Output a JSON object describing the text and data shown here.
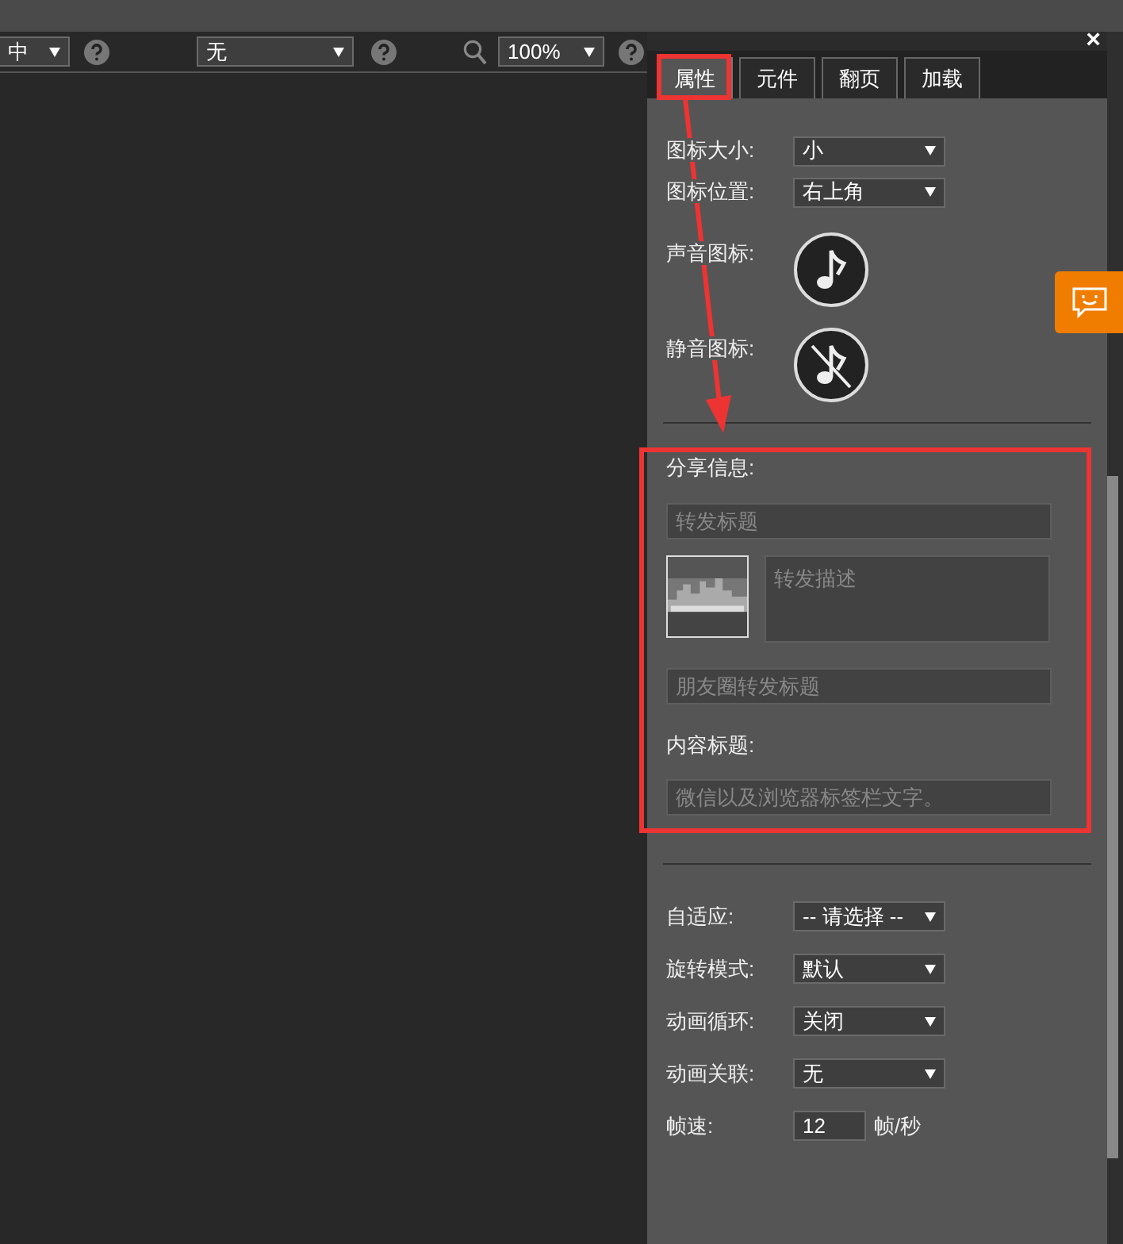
{
  "toolbar": {
    "selects": [
      {
        "value": "中"
      },
      {
        "value": "无"
      },
      {
        "value": "100%"
      }
    ]
  },
  "panel": {
    "close": "×",
    "tabs": [
      {
        "label": "属性",
        "selected": true
      },
      {
        "label": "元件",
        "selected": false
      },
      {
        "label": "翻页",
        "selected": false
      },
      {
        "label": "加载",
        "selected": false
      }
    ],
    "icon_settings": [
      {
        "label": "图标大小:",
        "value": "小"
      },
      {
        "label": "图标位置:",
        "value": "右上角"
      }
    ],
    "sound_icons": [
      {
        "label": "声音图标:",
        "kind": "sound"
      },
      {
        "label": "静音图标:",
        "kind": "mute"
      }
    ],
    "share": {
      "heading": "分享信息:",
      "title_placeholder": "转发标题",
      "description_placeholder": "转发描述",
      "moments_placeholder": "朋友圈转发标题",
      "content_heading": "内容标题:",
      "content_placeholder": "微信以及浏览器标签栏文字。"
    },
    "settings": [
      {
        "label": "自适应:",
        "kind": "select",
        "value": "-- 请选择 --"
      },
      {
        "label": "旋转模式:",
        "kind": "select",
        "value": "默认"
      },
      {
        "label": "动画循环:",
        "kind": "select",
        "value": "关闭"
      },
      {
        "label": "动画关联:",
        "kind": "select",
        "value": "无"
      },
      {
        "label": "帧速:",
        "kind": "number",
        "value": "12",
        "unit": "帧/秒"
      }
    ]
  }
}
